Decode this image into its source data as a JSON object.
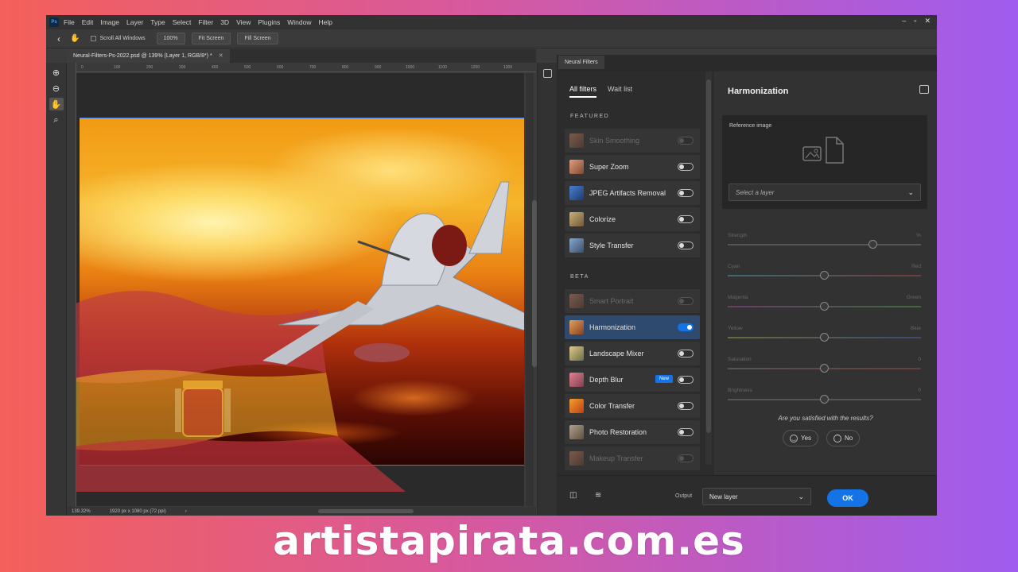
{
  "menubar": {
    "logo": "Ps",
    "items": [
      "File",
      "Edit",
      "Image",
      "Layer",
      "Type",
      "Select",
      "Filter",
      "3D",
      "View",
      "Plugins",
      "Window",
      "Help"
    ]
  },
  "options": {
    "scroll_all": "Scroll All Windows",
    "zoom": "100%",
    "fit_screen": "Fit Screen",
    "fill_screen": "Fill Screen"
  },
  "document": {
    "tab_title": "Neural-Filters-Ps-2022.psd @ 139% (Layer 1, RGB/8*) *",
    "ruler_ticks": [
      "0",
      "100",
      "200",
      "300",
      "400",
      "500",
      "600",
      "700",
      "800",
      "900",
      "1000",
      "1100",
      "1200",
      "1300"
    ],
    "status_zoom": "139.32%",
    "status_info": "1920 px x 1080 px (72 ppi)"
  },
  "neural_filters": {
    "panel_tab": "Neural Filters",
    "tab_all": "All filters",
    "tab_wait": "Wait list",
    "featured_label": "FEATURED",
    "beta_label": "BETA",
    "featured": [
      {
        "label": "Skin Smoothing",
        "state": "disabled"
      },
      {
        "label": "Super Zoom",
        "state": "off"
      },
      {
        "label": "JPEG Artifacts Removal",
        "state": "off"
      },
      {
        "label": "Colorize",
        "state": "off"
      },
      {
        "label": "Style Transfer",
        "state": "off"
      }
    ],
    "beta": [
      {
        "label": "Smart Portrait",
        "state": "disabled"
      },
      {
        "label": "Harmonization",
        "state": "on"
      },
      {
        "label": "Landscape Mixer",
        "state": "off"
      },
      {
        "label": "Depth Blur",
        "state": "off",
        "badge": "New"
      },
      {
        "label": "Color Transfer",
        "state": "off"
      },
      {
        "label": "Photo Restoration",
        "state": "off"
      },
      {
        "label": "Makeup Transfer",
        "state": "disabled"
      }
    ]
  },
  "harmonization": {
    "title": "Harmonization",
    "reference_label": "Reference image",
    "select_placeholder": "Select a layer",
    "sliders": [
      {
        "label": "Strength",
        "end": "%",
        "value": 0.75
      },
      {
        "label": "Cyan",
        "end": "Red",
        "value": 0.5
      },
      {
        "label": "Magenta",
        "end": "Green",
        "value": 0.5
      },
      {
        "label": "Yellow",
        "end": "Blue",
        "value": 0.5
      },
      {
        "label": "Saturation",
        "end": "0",
        "value": 0.5
      },
      {
        "label": "Brightness",
        "end": "0",
        "value": 0.5
      }
    ],
    "question": "Are you satisfied with the results?",
    "yes": "Yes",
    "no": "No"
  },
  "footer": {
    "output_label": "Output",
    "output_value": "New layer",
    "ok": "OK"
  },
  "site": "artistapirata.com.es",
  "colors": {
    "accent": "#1473e6",
    "bg_gradient_left": "#f4605a",
    "bg_gradient_right": "#9f5cef"
  }
}
